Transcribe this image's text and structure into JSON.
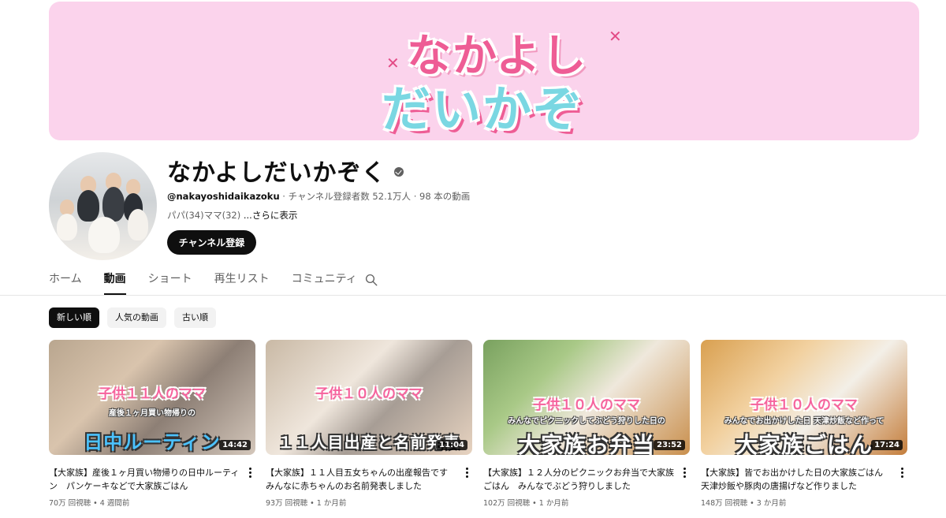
{
  "banner": {
    "logo_line1": "なかよし",
    "logo_line2": "だいかぞく"
  },
  "channel": {
    "name": "なかよしだいかぞく",
    "handle": "@nakayoshidaikazoku",
    "stats": " ‧ チャンネル登録者数 52.1万人 ‧ 98 本の動画",
    "description": "パパ(34)ママ(32) ",
    "more_label": "...さらに表示",
    "subscribe_label": "チャンネル登録"
  },
  "tabs": [
    {
      "label": "ホーム",
      "active": false
    },
    {
      "label": "動画",
      "active": true
    },
    {
      "label": "ショート",
      "active": false
    },
    {
      "label": "再生リスト",
      "active": false
    },
    {
      "label": "コミュニティ",
      "active": false
    }
  ],
  "chips": [
    {
      "label": "新しい順",
      "active": true
    },
    {
      "label": "人気の動画",
      "active": false
    },
    {
      "label": "古い順",
      "active": false
    }
  ],
  "videos": [
    {
      "overlay_top": "子供１１人のママ",
      "overlay_sub": "産後１ヶ月買い物帰りの",
      "overlay_main": "日中ルーティン",
      "duration": "14:42",
      "title": "【大家族】産後１ヶ月買い物帰りの日中ルーティン　パンケーキなどで大家族ごはん",
      "meta": "70万 回視聴 • 4 週間前"
    },
    {
      "overlay_top": "子供１０人のママ",
      "overlay_sub": "",
      "overlay_main": "１１人目出産と名前発表",
      "duration": "11:04",
      "title": "【大家族】１１人目五女ちゃんの出産報告です　みんなに赤ちゃんのお名前発表しました",
      "meta": "93万 回視聴 • 1 か月前"
    },
    {
      "overlay_top": "子供１０人のママ",
      "overlay_sub": "みんなでピクニックしてぶどう狩りした日の",
      "overlay_main": "大家族お弁当",
      "duration": "23:52",
      "title": "【大家族】１２人分のピクニックお弁当で大家族ごはん　みんなでぶどう狩りしました",
      "meta": "102万 回視聴 • 1 か月前"
    },
    {
      "overlay_top": "子供１０人のママ",
      "overlay_sub": "みんなでお出かけした日 天津炒飯など作って",
      "overlay_main": "大家族ごはん",
      "duration": "17:24",
      "title": "【大家族】皆でお出かけした日の大家族ごはん　天津炒飯や豚肉の唐揚げなど作りました",
      "meta": "148万 回視聴 • 3 か月前"
    }
  ]
}
